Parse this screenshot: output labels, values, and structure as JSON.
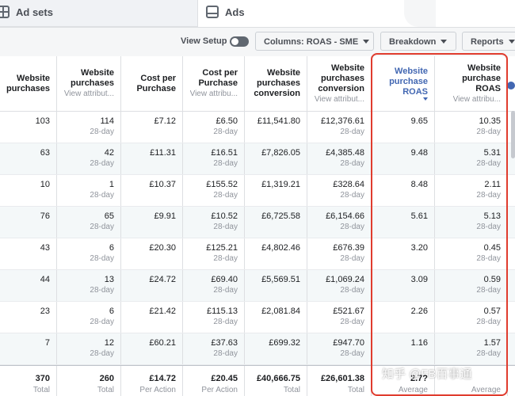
{
  "tabs": {
    "ad_sets_label": "Ad sets",
    "ads_label": "Ads"
  },
  "toolbar": {
    "view_setup_label": "View Setup",
    "columns_label": "Columns: ROAS - SME",
    "breakdown_label": "Breakdown",
    "reports_label": "Reports"
  },
  "columns": [
    {
      "title": "Website purchases",
      "sub": ""
    },
    {
      "title": "Website purchases",
      "sub": "View attribut..."
    },
    {
      "title": "Cost per Purchase",
      "sub": ""
    },
    {
      "title": "Cost per Purchase",
      "sub": "View attribu..."
    },
    {
      "title": "Website purchases conversion",
      "sub": ""
    },
    {
      "title": "Website purchases conversion",
      "sub": "View attribut..."
    },
    {
      "title": "Website purchase ROAS",
      "sub": ""
    },
    {
      "title": "Website purchase ROAS",
      "sub": "View attribu..."
    }
  ],
  "rows": [
    [
      "103",
      "114",
      "£7.12",
      "£6.50",
      "£11,541.80",
      "£12,376.61",
      "9.65",
      "10.35"
    ],
    [
      "63",
      "42",
      "£11.31",
      "£16.51",
      "£7,826.05",
      "£4,385.48",
      "9.48",
      "5.31"
    ],
    [
      "10",
      "1",
      "£10.37",
      "£155.52",
      "£1,319.21",
      "£328.64",
      "8.48",
      "2.11"
    ],
    [
      "76",
      "65",
      "£9.91",
      "£10.52",
      "£6,725.58",
      "£6,154.66",
      "5.61",
      "5.13"
    ],
    [
      "43",
      "6",
      "£20.30",
      "£125.21",
      "£4,802.46",
      "£676.39",
      "3.20",
      "0.45"
    ],
    [
      "44",
      "13",
      "£24.72",
      "£69.40",
      "£5,569.51",
      "£1,069.24",
      "3.09",
      "0.59"
    ],
    [
      "23",
      "6",
      "£21.42",
      "£115.13",
      "£2,081.84",
      "£521.67",
      "2.26",
      "0.57"
    ],
    [
      "7",
      "12",
      "£60.21",
      "£37.63",
      "£699.32",
      "£947.70",
      "1.16",
      "1.57"
    ]
  ],
  "row_sub_label": "28-day",
  "totals": {
    "values": [
      "370",
      "260",
      "£14.72",
      "£20.45",
      "£40,666.75",
      "£26,601.38",
      "2.7?",
      ""
    ],
    "subs": [
      "Total",
      "Total",
      "Per Action",
      "Per Action",
      "Total",
      "Total",
      "Average",
      "Average"
    ]
  },
  "watermark": "知乎 @FB百事通",
  "colors": {
    "highlight_border": "#e03c2e",
    "sorted_header": "#4267b2",
    "row_stripe": "#f4f8f9"
  }
}
